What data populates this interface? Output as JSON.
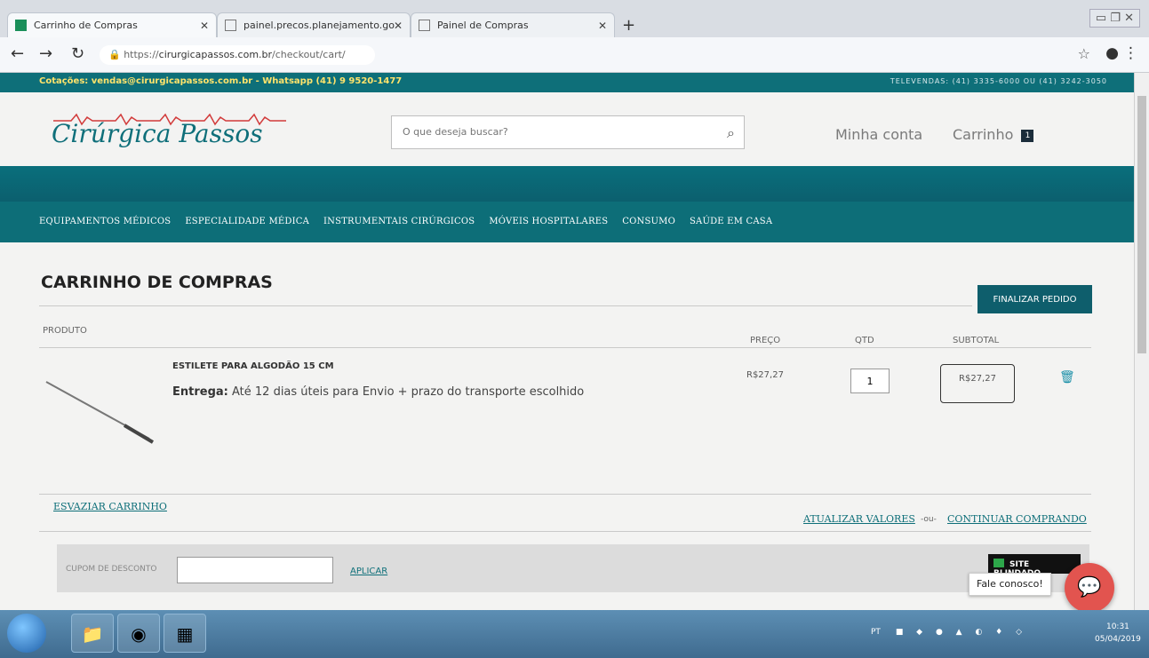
{
  "browser": {
    "tabs": [
      {
        "label": "Carrinho de Compras",
        "active": true
      },
      {
        "label": "painel.precos.planejamento.gov",
        "active": false
      },
      {
        "label": "Painel de Compras",
        "active": false
      }
    ],
    "url_prefix": "https://",
    "url_domain": "cirurgicapassos.com.br",
    "url_path": "/checkout/cart/"
  },
  "top_strip": {
    "left": "Cotações: vendas@cirurgicapassos.com.br - Whatsapp (41) 9 9520-1477",
    "right": "TELEVENDAS: (41) 3335-6000 OU (41) 3242-3050"
  },
  "header": {
    "logo": "Cirúrgica Passos",
    "search_placeholder": "O que deseja buscar?",
    "minha_conta": "Minha conta",
    "carrinho": "Carrinho",
    "cart_count": "1"
  },
  "categories": [
    "EQUIPAMENTOS MÉDICOS",
    "ESPECIALIDADE MÉDICA",
    "INSTRUMENTAIS CIRÚRGICOS",
    "MÓVEIS HOSPITALARES",
    "CONSUMO",
    "SAÚDE EM CASA"
  ],
  "cart": {
    "title": "CARRINHO DE COMPRAS",
    "finalizar": "FINALIZAR PEDIDO",
    "columns": {
      "produto": "PRODUTO",
      "preco": "PREÇO",
      "qtd": "QTD",
      "subtotal": "SUBTOTAL"
    },
    "item": {
      "name": "ESTILETE PARA ALGODÃO 15 CM",
      "entrega_label": "Entrega:",
      "entrega_text": "Até 12 dias úteis para Envio + prazo do transporte escolhido",
      "price": "R$27,27",
      "qty": "1",
      "subtotal": "R$27,27"
    },
    "esvaziar": "ESVAZIAR CARRINHO",
    "atualizar": "ATUALIZAR VALORES",
    "or": "-ou-",
    "continuar": "CONTINUAR COMPRANDO",
    "cupom_label": "CUPOM DE DESCONTO",
    "aplicar": "APLICAR",
    "site_blindado": "SITE BLINDADO",
    "fale": "Fale conosco!"
  },
  "taskbar": {
    "lang": "PT",
    "time": "10:31",
    "date": "05/04/2019"
  },
  "colors": {
    "brand": "#0e6f79",
    "accent": "#ffe36b",
    "chat": "#e2544f"
  }
}
